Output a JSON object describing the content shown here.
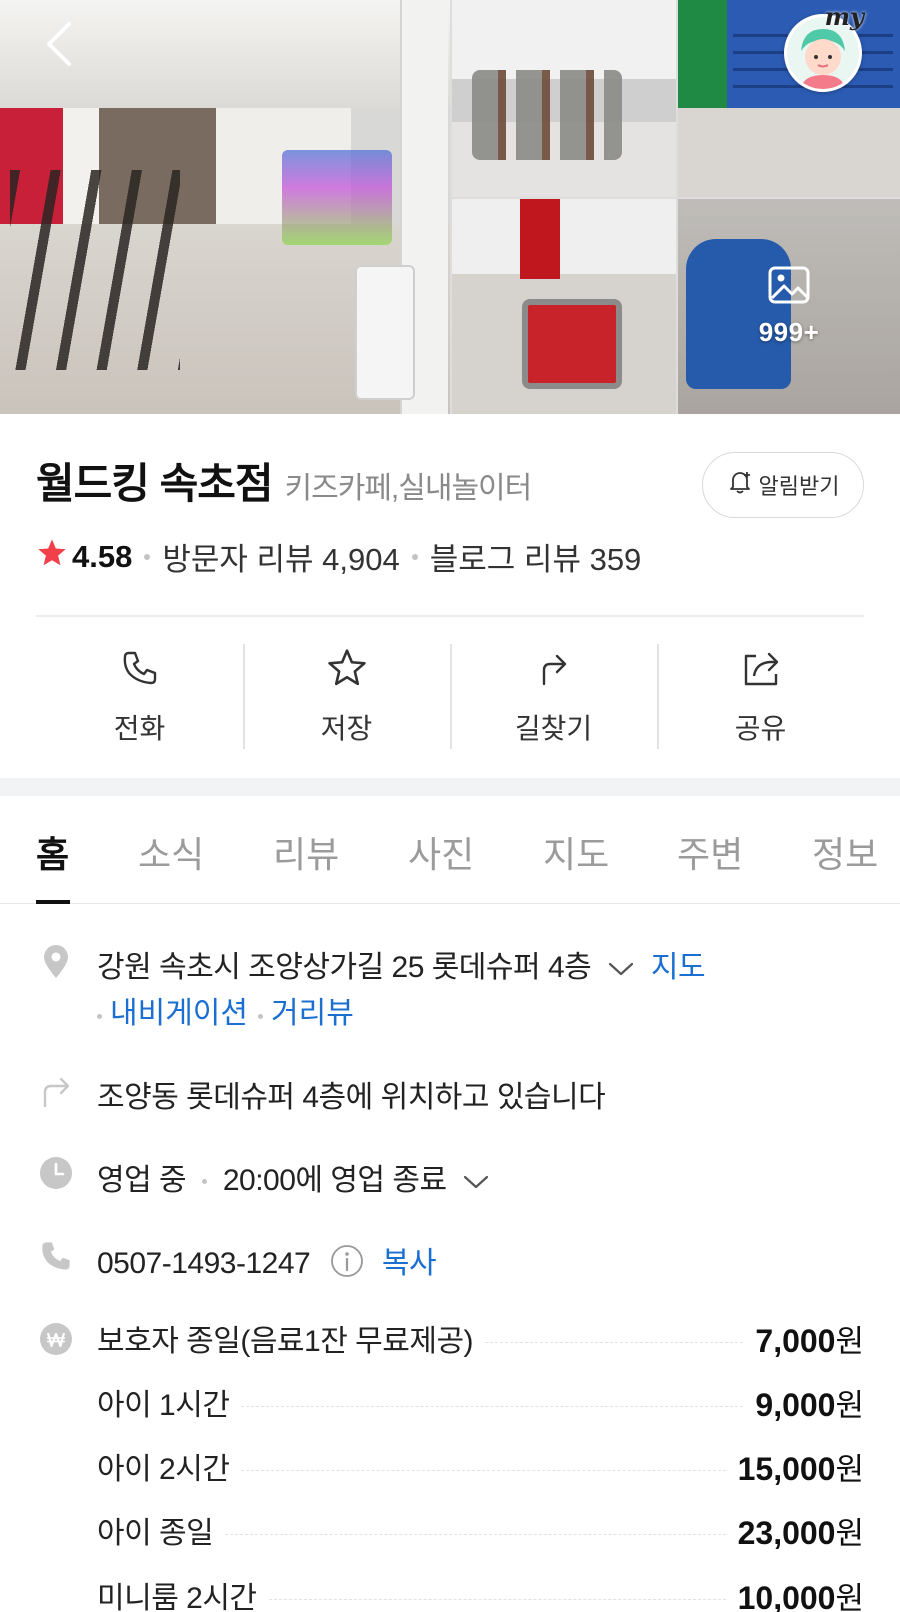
{
  "gallery": {
    "more_count": "999+",
    "my_label": "my"
  },
  "place": {
    "name": "월드킹 속초점",
    "category": "키즈카페,실내놀이터",
    "notify_label": "알림받기",
    "rating": "4.58",
    "visitor_reviews": "방문자 리뷰 4,904",
    "blog_reviews": "블로그 리뷰 359"
  },
  "actions": [
    {
      "label": "전화",
      "icon": "phone-icon"
    },
    {
      "label": "저장",
      "icon": "star-icon"
    },
    {
      "label": "길찾기",
      "icon": "directions-icon"
    },
    {
      "label": "공유",
      "icon": "share-icon"
    }
  ],
  "tabs": [
    {
      "label": "홈",
      "active": true
    },
    {
      "label": "소식"
    },
    {
      "label": "리뷰"
    },
    {
      "label": "사진"
    },
    {
      "label": "지도"
    },
    {
      "label": "주변"
    },
    {
      "label": "정보"
    }
  ],
  "info": {
    "address": "강원 속초시 조양상가길 25 롯데슈퍼 4층",
    "map_link": "지도",
    "navigation_link": "내비게이션",
    "street_view_link": "거리뷰",
    "directions_text": "조양동 롯데슈퍼 4층에 위치하고 있습니다",
    "hours_status": "영업 중",
    "hours_detail": "20:00에 영업 종료",
    "phone": "0507-1493-1247",
    "copy_label": "복사"
  },
  "prices": [
    {
      "name": "보호자 종일(음료1잔 무료제공)",
      "value": "7,000",
      "unit": "원"
    },
    {
      "name": "아이 1시간",
      "value": "9,000",
      "unit": "원"
    },
    {
      "name": "아이 2시간",
      "value": "15,000",
      "unit": "원"
    },
    {
      "name": "아이 종일",
      "value": "23,000",
      "unit": "원"
    },
    {
      "name": "미니룸 2시간",
      "value": "10,000",
      "unit": "원"
    }
  ],
  "colors": {
    "star": "#f2404b",
    "link": "#1a6fd1",
    "text": "#222222",
    "muted": "#8a8a8a"
  }
}
